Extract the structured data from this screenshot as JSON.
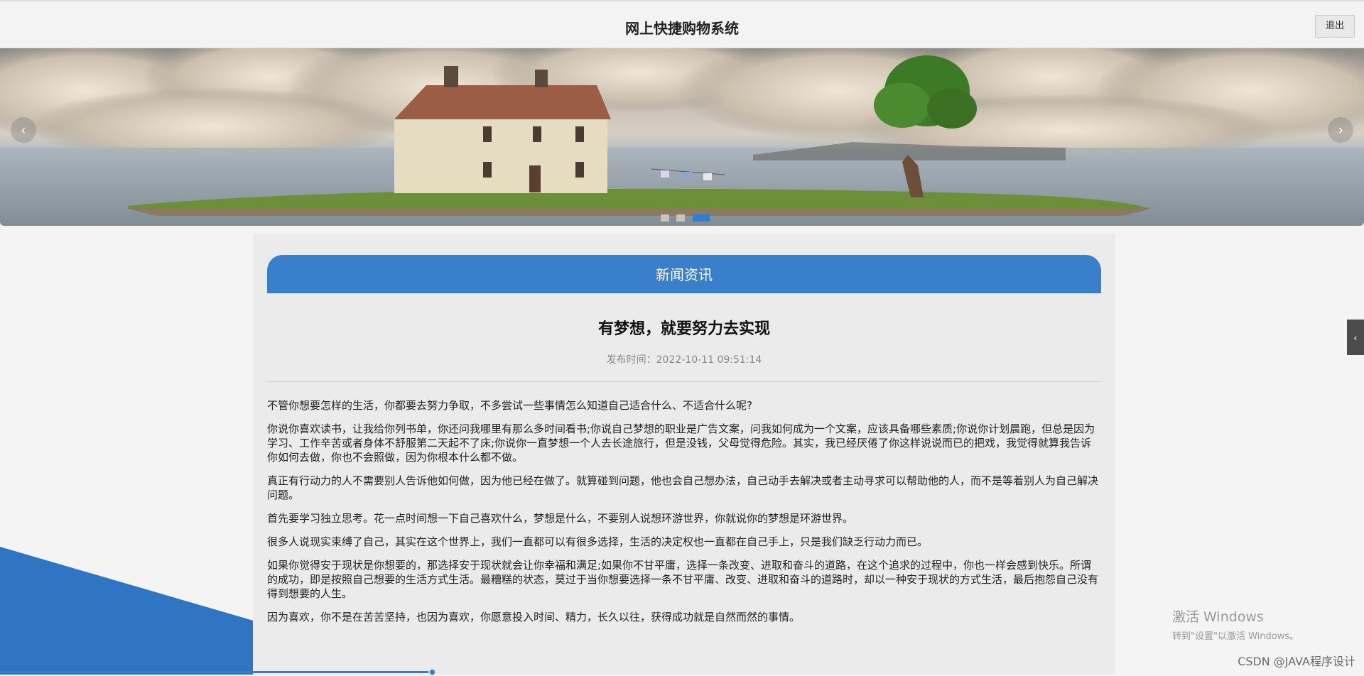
{
  "header": {
    "title": "网上快捷购物系统",
    "logout_label": "退出"
  },
  "carousel": {
    "prev_icon": "chevron-left-icon",
    "next_icon": "chevron-right-icon",
    "slides": 3,
    "active_index": 2
  },
  "news": {
    "section_title": "新闻资讯",
    "article_title": "有梦想，就要努力去实现",
    "publish_time": "发布时间：2022-10-11 09:51:14",
    "paragraphs": [
      "不管你想要怎样的生活，你都要去努力争取，不多尝试一些事情怎么知道自己适合什么、不适合什么呢?",
      "你说你喜欢读书，让我给你列书单，你还问我哪里有那么多时间看书;你说自己梦想的职业是广告文案，问我如何成为一个文案，应该具备哪些素质;你说你计划晨跑，但总是因为学习、工作辛苦或者身体不舒服第二天起不了床;你说你一直梦想一个人去长途旅行，但是没钱，父母觉得危险。其实，我已经厌倦了你这样说说而已的把戏，我觉得就算我告诉你如何去做，你也不会照做，因为你根本什么都不做。",
      "真正有行动力的人不需要别人告诉他如何做，因为他已经在做了。就算碰到问题，他也会自己想办法，自己动手去解决或者主动寻求可以帮助他的人，而不是等着别人为自己解决问题。",
      "首先要学习独立思考。花一点时间想一下自己喜欢什么，梦想是什么，不要别人说想环游世界，你就说你的梦想是环游世界。",
      "很多人说现实束缚了自己，其实在这个世界上，我们一直都可以有很多选择，生活的决定权也一直都在自己手上，只是我们缺乏行动力而已。",
      "如果你觉得安于现状是你想要的，那选择安于现状就会让你幸福和满足;如果你不甘平庸，选择一条改变、进取和奋斗的道路，在这个追求的过程中，你也一样会感到快乐。所谓的成功，即是按照自己想要的生活方式生活。最糟糕的状态，莫过于当你想要选择一条不甘平庸、改变、进取和奋斗的道路时，却以一种安于现状的方式生活，最后抱怨自己没有得到想要的人生。",
      "因为喜欢，你不是在苦苦坚持，也因为喜欢，你愿意投入时间、精力，长久以往，获得成功就是自然而然的事情。"
    ]
  },
  "side_tab_icon": "chevron-left-icon",
  "watermark": {
    "activate_title": "激活 Windows",
    "activate_hint": "转到\"设置\"以激活 Windows。",
    "csdn": "CSDN @JAVA程序设计"
  },
  "colors": {
    "accent": "#3a7fc9",
    "panel_bg": "#ebebeb",
    "page_bg": "#f4f4f4"
  }
}
